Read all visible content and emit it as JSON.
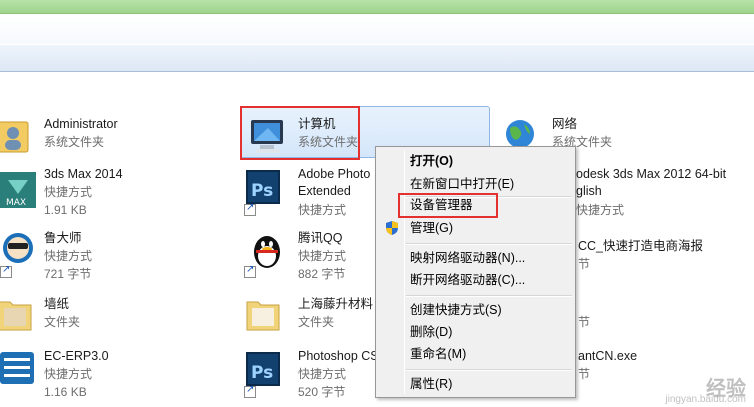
{
  "files": [
    {
      "name": "Administrator",
      "meta": "系统文件夹",
      "icon": "user-folder-icon"
    },
    {
      "name": "计算机",
      "meta": "系统文件夹",
      "icon": "computer-icon"
    },
    {
      "name": "网络",
      "meta": "系统文件夹",
      "icon": "network-globe-icon"
    },
    {
      "name": "3ds Max 2014",
      "meta": "快捷方式",
      "size": "1.91 KB",
      "icon": "3ds-max-icon"
    },
    {
      "name1": "Adobe Photo",
      "name2": "Extended",
      "meta": "快捷方式",
      "icon": "photoshop-icon"
    },
    {
      "name1": "odesk 3ds Max 2012 64-bit",
      "name2": "glish",
      "meta": "快捷方式",
      "icon": "3ds-max-icon"
    },
    {
      "name": "鲁大师",
      "meta": "快捷方式",
      "size": "721 字节",
      "icon": "ludashi-icon"
    },
    {
      "name": "腾讯QQ",
      "meta": "快捷方式",
      "size": "882 字节",
      "icon": "qq-penguin-icon"
    },
    {
      "name": "CC_快速打造电商海报",
      "meta": "节",
      "icon": "file-icon"
    },
    {
      "name": "墙纸",
      "meta": "文件夹",
      "icon": "folder-icon"
    },
    {
      "name": "上海藤升材料",
      "meta": "文件夹",
      "icon": "folder-icon"
    },
    {
      "name": "",
      "meta": "节",
      "icon": "file-icon"
    },
    {
      "name": "EC-ERP3.0",
      "meta": "快捷方式",
      "size": "1.16 KB",
      "icon": "erp-icon"
    },
    {
      "name": "Photoshop CS",
      "meta": "快捷方式",
      "size": "520 字节",
      "icon": "photoshop-icon"
    },
    {
      "name": "antCN.exe",
      "meta": "节",
      "icon": "exe-icon"
    }
  ],
  "context_menu": {
    "items": [
      {
        "label": "打开(O)",
        "bold": true
      },
      {
        "label": "在新窗口中打开(E)"
      },
      {
        "label": "设备管理器"
      },
      {
        "label": "管理(G)",
        "icon": "uac-shield-icon"
      },
      {
        "label": "映射网络驱动器(N)..."
      },
      {
        "label": "断开网络驱动器(C)..."
      },
      {
        "label": "创建快捷方式(S)"
      },
      {
        "label": "删除(D)"
      },
      {
        "label": "重命名(M)"
      },
      {
        "label": "属性(R)"
      }
    ]
  },
  "watermark": {
    "brand": "经验",
    "sub": "jingyan.baidu.com"
  },
  "colors": {
    "highlight_red": "#e53030",
    "selection_blue": "#d4e6fa"
  }
}
